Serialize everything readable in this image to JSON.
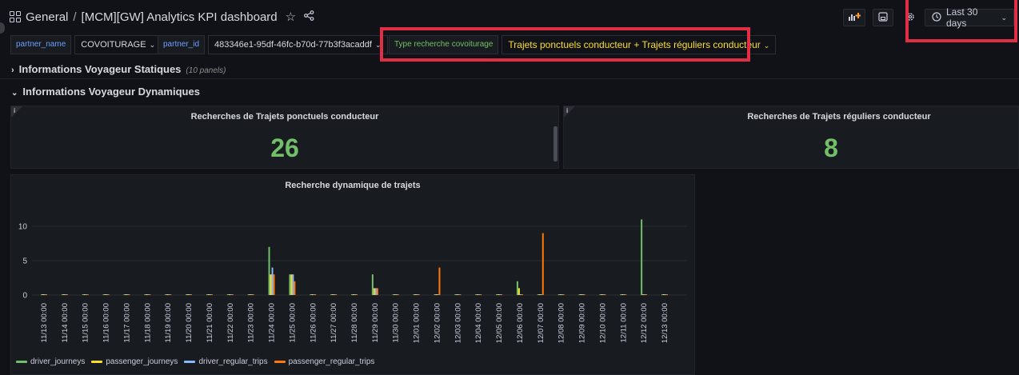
{
  "breadcrumb": {
    "section": "General",
    "separator": "/",
    "title": "[MCM][GW] Analytics KPI dashboard"
  },
  "icons": {
    "apps": "grid-icon",
    "star": "star-icon",
    "share": "share-icon",
    "add_panel": "add-panel-icon",
    "save": "save-icon",
    "settings": "gear-icon",
    "clock": "clock-icon",
    "caret": "chevron-down-icon"
  },
  "toolbar": {
    "time_range": "Last 30 days"
  },
  "variables": {
    "partner_name_label": "partner_name",
    "partner_name_value": "COVOITURAGE",
    "partner_id_label": "partner_id",
    "partner_id_value": "483346e1-95df-46fc-b70d-77b3f3acaddf",
    "type_label": "Type recherche covoiturage",
    "type_value": "Trajets ponctuels conducteur + Trajets réguliers conducteur"
  },
  "rows": {
    "static_title": "Informations Voyageur Statiques",
    "static_count": "(10 panels)",
    "dynamic_title": "Informations Voyageur Dynamiques"
  },
  "panels": {
    "stat1": {
      "title": "Recherches de Trajets ponctuels conducteur",
      "value": "26",
      "info": "i"
    },
    "stat2": {
      "title": "Recherches de Trajets réguliers conducteur",
      "value": "8",
      "info": "i"
    }
  },
  "colors": {
    "background": "#111217",
    "panel": "#181b1f",
    "stat_green": "#73bf69",
    "highlight_red": "#e02f44",
    "variable_blue": "#6e9fff",
    "variable_yellow": "#fade2a"
  },
  "chart_data": {
    "type": "bar",
    "title": "Recherche dynamique de trajets",
    "xlabel": "",
    "ylabel": "",
    "ylim": [
      0,
      12
    ],
    "yticks": [
      0,
      5,
      10
    ],
    "grid": true,
    "legend_position": "bottom-left",
    "categories": [
      "11/13 00:00",
      "11/14 00:00",
      "11/15 00:00",
      "11/16 00:00",
      "11/17 00:00",
      "11/18 00:00",
      "11/19 00:00",
      "11/20 00:00",
      "11/21 00:00",
      "11/22 00:00",
      "11/23 00:00",
      "11/24 00:00",
      "11/25 00:00",
      "11/26 00:00",
      "11/27 00:00",
      "11/28 00:00",
      "11/29 00:00",
      "11/30 00:00",
      "12/01 00:00",
      "12/02 00:00",
      "12/03 00:00",
      "12/04 00:00",
      "12/05 00:00",
      "12/06 00:00",
      "12/07 00:00",
      "12/08 00:00",
      "12/09 00:00",
      "12/10 00:00",
      "12/11 00:00",
      "12/12 00:00",
      "12/13 00:00"
    ],
    "series": [
      {
        "name": "driver_journeys",
        "color": "#73bf69",
        "values": [
          0,
          0,
          0,
          0,
          0,
          0,
          0,
          0,
          0,
          0,
          0,
          7,
          3,
          0,
          0,
          0,
          3,
          0,
          0,
          0,
          0,
          0,
          0,
          2,
          0,
          0,
          0,
          0,
          0,
          11,
          0
        ]
      },
      {
        "name": "passenger_journeys",
        "color": "#fade2a",
        "values": [
          0,
          0,
          0,
          0,
          0,
          0,
          0,
          0,
          0,
          0,
          0,
          3,
          3,
          0,
          0,
          0,
          1,
          0,
          0,
          0,
          0,
          0,
          0,
          1,
          0,
          0,
          0,
          0,
          0,
          0,
          0
        ]
      },
      {
        "name": "driver_regular_trips",
        "color": "#8ab8ff",
        "values": [
          0,
          0,
          0,
          0,
          0,
          0,
          0,
          0,
          0,
          0,
          0,
          4,
          3,
          0,
          0,
          0,
          1,
          0,
          0,
          0,
          0,
          0,
          0,
          0,
          0,
          0,
          0,
          0,
          0,
          0,
          0
        ]
      },
      {
        "name": "passenger_regular_trips",
        "color": "#ff780a",
        "values": [
          0,
          0,
          0,
          0,
          0,
          0,
          0,
          0,
          0,
          0,
          0,
          3,
          2,
          0,
          0,
          0,
          1,
          0,
          0,
          4,
          0,
          0,
          0,
          0,
          9,
          0,
          0,
          0,
          0,
          0,
          0
        ]
      }
    ]
  }
}
